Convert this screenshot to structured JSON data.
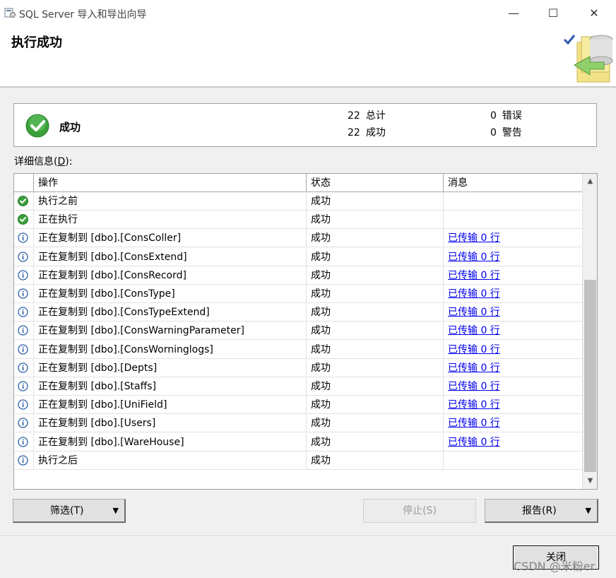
{
  "window": {
    "title": "SQL Server 导入和导出向导",
    "minimize_label": "—",
    "maximize_label": "☐",
    "close_label": "✕"
  },
  "header": {
    "title": "执行成功"
  },
  "summary": {
    "status": "成功",
    "total_count": "22",
    "total_label": "总计",
    "success_count": "22",
    "success_label": "成功",
    "error_count": "0",
    "error_label": "错误",
    "warning_count": "0",
    "warning_label": "警告"
  },
  "details": {
    "label": "详细信息(",
    "hotkey": "D",
    "suffix": "):",
    "columns": [
      "操作",
      "状态",
      "消息"
    ],
    "rows": [
      {
        "icon": "success-icon",
        "operation": "执行之前",
        "status": "成功",
        "message": ""
      },
      {
        "icon": "success-icon",
        "operation": "正在执行",
        "status": "成功",
        "message": ""
      },
      {
        "icon": "info-icon",
        "operation": "正在复制到 [dbo].[ConsColler]",
        "status": "成功",
        "message": "已传输 0 行"
      },
      {
        "icon": "info-icon",
        "operation": "正在复制到 [dbo].[ConsExtend]",
        "status": "成功",
        "message": "已传输 0 行"
      },
      {
        "icon": "info-icon",
        "operation": "正在复制到 [dbo].[ConsRecord]",
        "status": "成功",
        "message": "已传输 0 行"
      },
      {
        "icon": "info-icon",
        "operation": "正在复制到 [dbo].[ConsType]",
        "status": "成功",
        "message": "已传输 0 行"
      },
      {
        "icon": "info-icon",
        "operation": "正在复制到 [dbo].[ConsTypeExtend]",
        "status": "成功",
        "message": "已传输 0 行"
      },
      {
        "icon": "info-icon",
        "operation": "正在复制到 [dbo].[ConsWarningParameter]",
        "status": "成功",
        "message": "已传输 0 行"
      },
      {
        "icon": "info-icon",
        "operation": "正在复制到 [dbo].[ConsWorninglogs]",
        "status": "成功",
        "message": "已传输 0 行"
      },
      {
        "icon": "info-icon",
        "operation": "正在复制到 [dbo].[Depts]",
        "status": "成功",
        "message": "已传输 0 行"
      },
      {
        "icon": "info-icon",
        "operation": "正在复制到 [dbo].[Staffs]",
        "status": "成功",
        "message": "已传输 0 行"
      },
      {
        "icon": "info-icon",
        "operation": "正在复制到 [dbo].[UniField]",
        "status": "成功",
        "message": "已传输 0 行"
      },
      {
        "icon": "info-icon",
        "operation": "正在复制到 [dbo].[Users]",
        "status": "成功",
        "message": "已传输 0 行"
      },
      {
        "icon": "info-icon",
        "operation": "正在复制到 [dbo].[WareHouse]",
        "status": "成功",
        "message": "已传输 0 行"
      },
      {
        "icon": "info-icon",
        "operation": "执行之后",
        "status": "成功",
        "message": ""
      }
    ]
  },
  "buttons": {
    "filter": "筛选(T)",
    "stop": "停止(S)",
    "report": "报告(R)",
    "close": "关闭"
  },
  "watermark": "CSDN @米粉er",
  "colors": {
    "link": "#0000ee",
    "success_green": "#3aa03a",
    "info_blue": "#2b5fa8"
  }
}
